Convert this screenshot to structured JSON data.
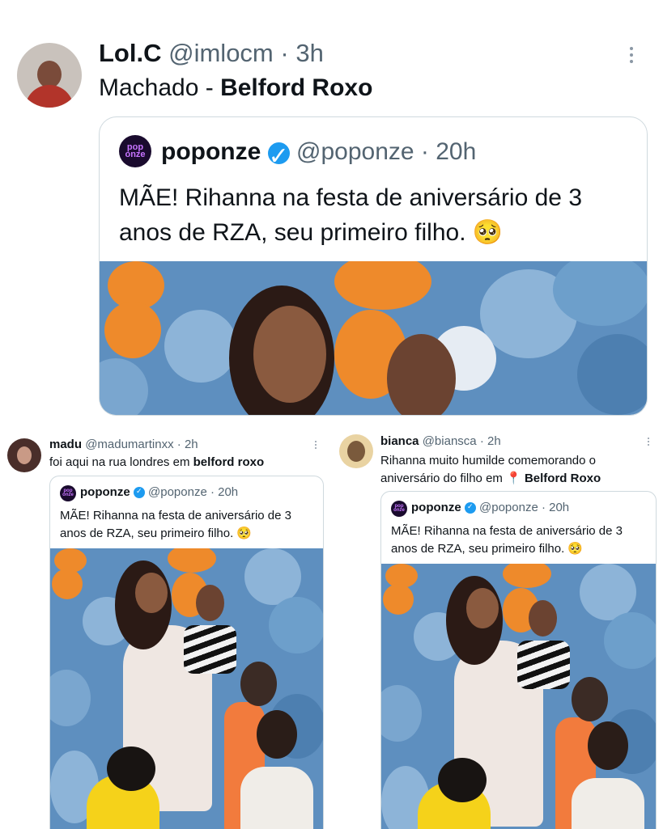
{
  "main_tweet": {
    "name": "Lol.C",
    "handle": "@imlocm",
    "sep": "·",
    "time": "3h",
    "text_prefix": "Machado - ",
    "text_bold": "Belford Roxo",
    "quote": {
      "logo_text": "pop onze",
      "name": "poponze",
      "handle": "@poponze",
      "sep": "·",
      "time": "20h",
      "text": "MÃE! Rihanna na festa de aniversário de 3 anos de RZA, seu primeiro filho. 🥺"
    }
  },
  "left_tweet": {
    "name": "madu",
    "handle": "@madumartinxx",
    "sep": "·",
    "time": "2h",
    "text_prefix": "foi aqui na rua londres em ",
    "text_bold": "belford roxo",
    "quote": {
      "logo_text": "pop onze",
      "name": "poponze",
      "handle": "@poponze",
      "sep": "·",
      "time": "20h",
      "text": "MÃE! Rihanna na festa de aniversário de 3 anos de RZA, seu primeiro filho. 🥺"
    }
  },
  "right_tweet": {
    "name": "bianca",
    "handle": "@biansca",
    "sep": "·",
    "time": "2h",
    "text_prefix": "Rihanna muito humilde comemorando o aniversário do filho em ",
    "pin_icon": "📍",
    "text_bold": "Belford Roxo",
    "quote": {
      "logo_text": "pop onze",
      "name": "poponze",
      "handle": "@poponze",
      "sep": "·",
      "time": "20h",
      "text": "MÃE! Rihanna na festa de aniversário de 3 anos de RZA, seu primeiro filho. 🥺"
    }
  },
  "colors": {
    "verified": "#1d9bf0",
    "muted": "#536471",
    "balloon_blue": "#6d9fcb",
    "balloon_orange": "#ee8a2b"
  }
}
